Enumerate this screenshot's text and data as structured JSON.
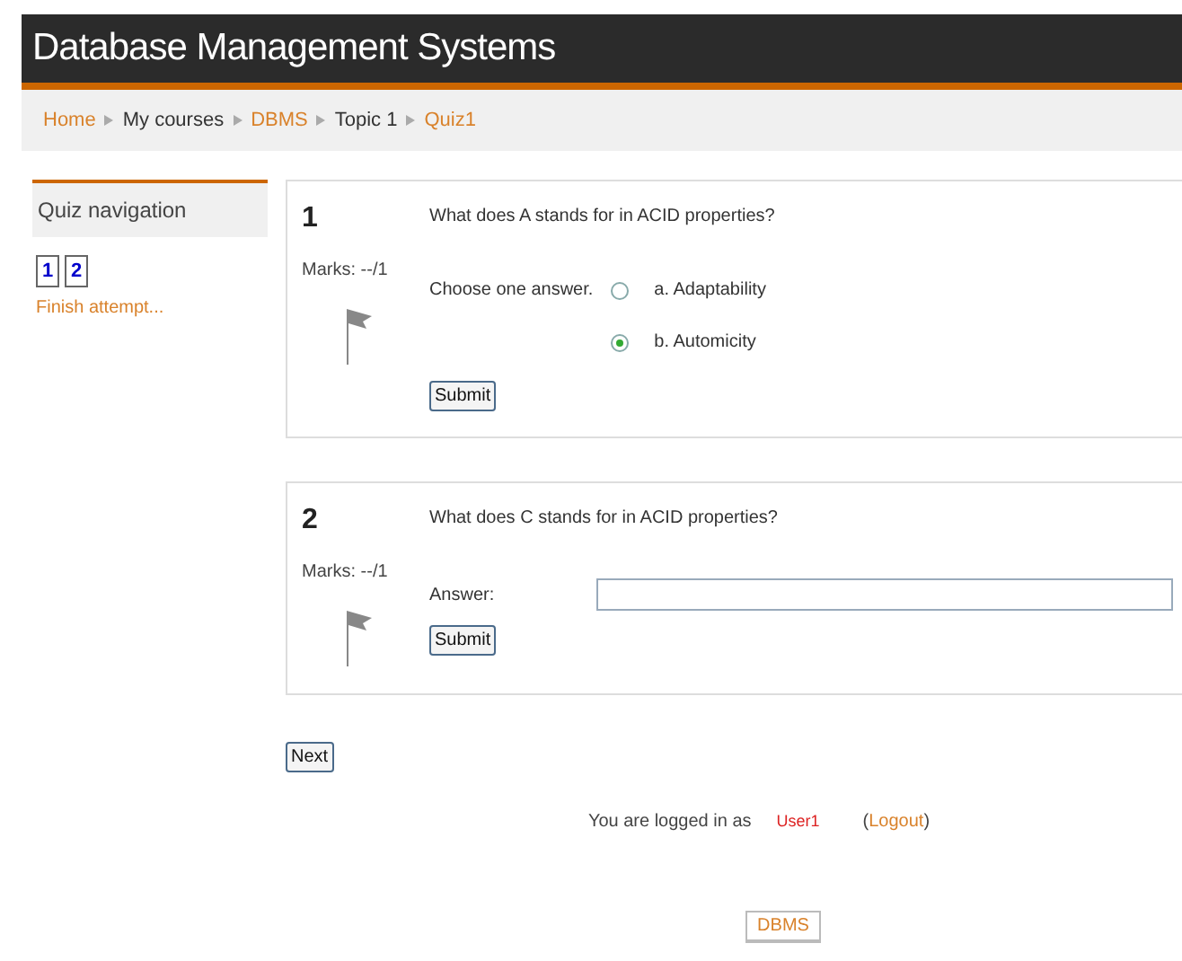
{
  "header": {
    "title": "Database Management Systems"
  },
  "breadcrumb": [
    {
      "label": "Home",
      "link": true
    },
    {
      "label": "My courses",
      "link": false
    },
    {
      "label": "DBMS",
      "link": true
    },
    {
      "label": "Topic 1",
      "link": false
    },
    {
      "label": "Quiz1",
      "link": true
    }
  ],
  "sidebar": {
    "title": "Quiz navigation",
    "pages": [
      "1",
      "2"
    ],
    "finish": "Finish attempt..."
  },
  "questions": [
    {
      "kind": "choice",
      "number": "1",
      "marks": "Marks: --/1",
      "text": "What does A stands for in ACID properties?",
      "prompt": "Choose one answer.",
      "options": [
        {
          "label": "a. Adaptability",
          "selected": false
        },
        {
          "label": "b. Automicity",
          "selected": true
        }
      ],
      "button": "Submit"
    },
    {
      "kind": "text",
      "number": "2",
      "marks": "Marks: --/1",
      "text": "What does C stands for in ACID properties?",
      "prompt": "Answer:",
      "button": "Submit"
    }
  ],
  "next": "Next",
  "footer": {
    "prefix": "You are logged in as",
    "user": "User1",
    "open": "(",
    "logout": "Logout",
    "close": ")",
    "course": "DBMS"
  }
}
